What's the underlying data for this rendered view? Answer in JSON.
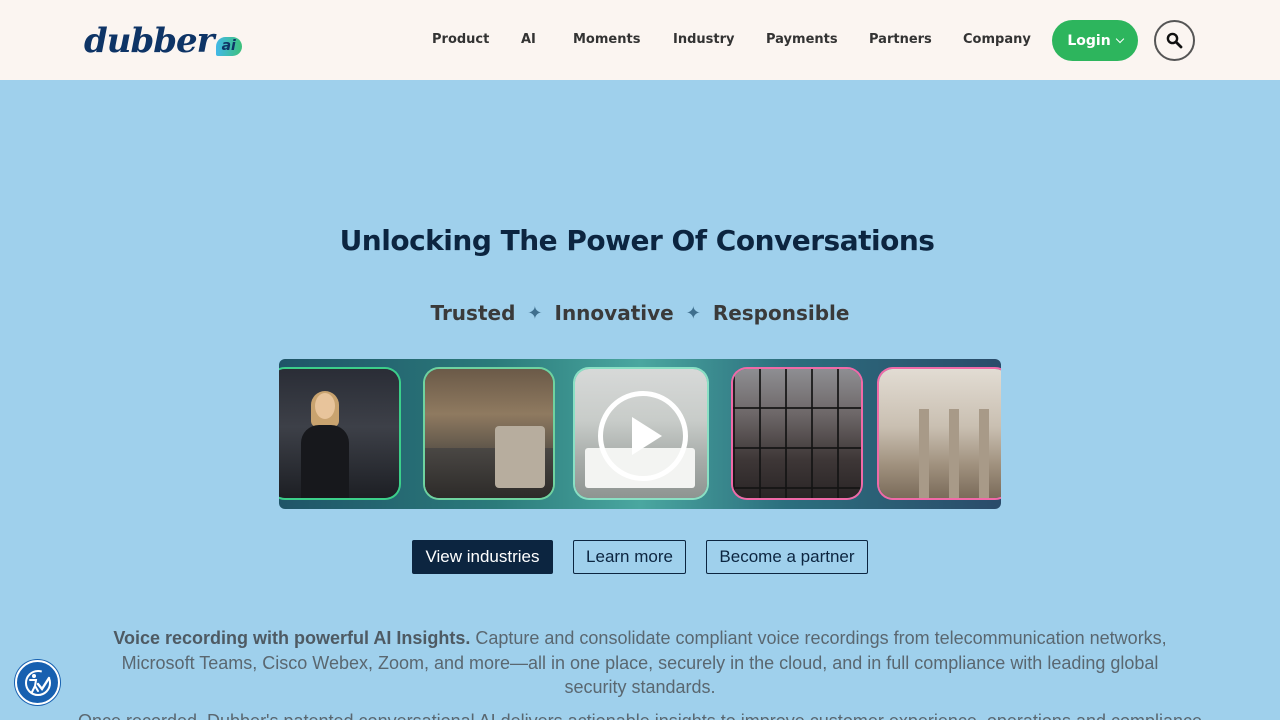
{
  "brand": {
    "logo_text": "dubber",
    "logo_badge": "ai"
  },
  "nav": {
    "items": [
      "Product",
      "AI",
      "Moments",
      "Industry",
      "Payments",
      "Partners",
      "Company"
    ],
    "login_label": "Login"
  },
  "hero": {
    "title": "Unlocking The Power Of Conversations",
    "values": [
      "Trusted",
      "Innovative",
      "Responsible"
    ],
    "sparkle_glyph": "✦"
  },
  "buttons": {
    "view_industries": "View industries",
    "learn_more": "Learn more",
    "become_partner": "Become a partner"
  },
  "description": {
    "bold_lead": "Voice recording with powerful AI Insights.",
    "body": " Capture and consolidate compliant voice recordings from telecommunication networks, Microsoft Teams, Cisco Webex, Zoom, and more—all in one place, securely in the cloud, and in full compliance with leading global security standards.",
    "next_line_partial": "Once recorded, Dubber's patented conversational AI delivers actionable insights to improve customer experience, operations and compliance"
  },
  "icons": {
    "search": "search-icon",
    "play": "play-icon",
    "accessibility": "accessibility-icon",
    "chevron": "chevron-down-icon"
  },
  "colors": {
    "header_bg": "#fbf5f1",
    "page_bg": "#9fd0ec",
    "login_green": "#2db55d",
    "navy": "#0c2540",
    "accessibility_blue": "#1760b0"
  }
}
